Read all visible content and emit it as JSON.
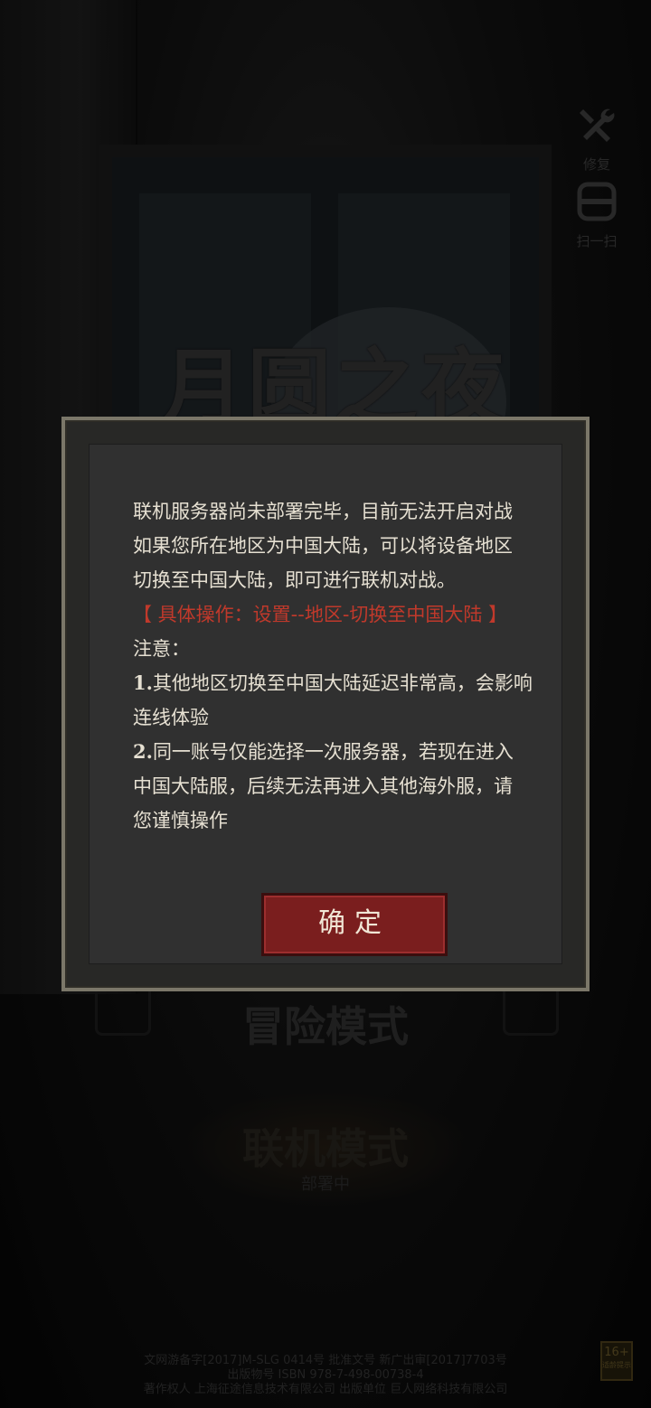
{
  "game": {
    "title": "月圆之夜"
  },
  "side_buttons": [
    {
      "label": "修复",
      "icon": "wrench-icon"
    },
    {
      "label": "扫一扫",
      "icon": "scan-icon"
    }
  ],
  "modes": {
    "adventure": "冒险模式",
    "online": "联机模式",
    "online_status": "部署中"
  },
  "dialog": {
    "lines": [
      "联机服务器尚未部署完毕，目前无法开启对战",
      "如果您所在地区为中国大陆，可以将设备地区",
      "切换至中国大陆，即可进行联机对战。",
      "【 具体操作：设置--地区-切换至中国大陆 】",
      "注意：",
      "其他地区切换至中国大陆延迟非常高，会影响",
      "连线体验",
      "同一账号仅能选择一次服务器，若现在进入",
      "中国大陆服，后续无法再进入其他海外服，请",
      "您谨慎操作"
    ],
    "note_numbers": [
      "1.",
      "2."
    ],
    "confirm_label": "确定",
    "highlight_color": "#c0392b"
  },
  "footer": {
    "line1": "文网游备字[2017]M-SLG 0414号 批准文号 新广出审[2017]7703号",
    "line2": "出版物号 ISBN 978-7-498-00738-4",
    "line3": "著作权人 上海征途信息技术有限公司 出版单位 巨人网络科技有限公司",
    "age_rating": "16+",
    "age_note": "适龄提示"
  }
}
